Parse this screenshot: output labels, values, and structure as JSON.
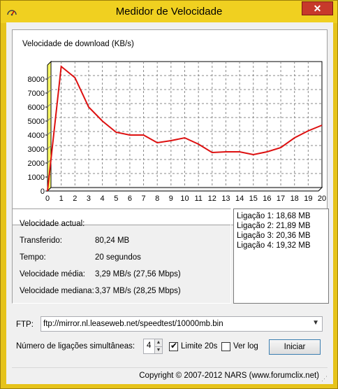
{
  "window": {
    "title": "Medidor de Velocidade",
    "icon": "speedometer-icon",
    "close_label": "✕"
  },
  "chart_data": {
    "type": "line",
    "title": "Velocidade de download (KB/s)",
    "x": [
      0,
      1,
      1.5,
      2,
      3,
      4,
      5,
      6,
      7,
      8,
      9,
      10,
      11,
      12,
      13,
      14,
      15,
      16,
      17,
      18,
      19,
      19.5,
      20
    ],
    "y": [
      0,
      8900,
      8500,
      8100,
      6000,
      5000,
      4200,
      4000,
      4000,
      3450,
      3600,
      3800,
      3350,
      2750,
      2800,
      2800,
      2600,
      2800,
      3100,
      3800,
      4300,
      4500,
      4700
    ],
    "xticks": [
      0,
      1,
      2,
      3,
      4,
      5,
      6,
      7,
      8,
      9,
      10,
      11,
      12,
      13,
      14,
      15,
      16,
      17,
      18,
      19,
      20
    ],
    "yticks": [
      0,
      1000,
      2000,
      3000,
      4000,
      5000,
      6000,
      7000,
      8000
    ],
    "xlim": [
      0,
      20
    ],
    "ylim": [
      0,
      9000
    ],
    "grid": true,
    "series_color": "#dd1010"
  },
  "stats": {
    "current_speed": {
      "label": "Velocidade actual:",
      "value": ""
    },
    "transferred": {
      "label": "Transferido:",
      "value": "80,24 MB"
    },
    "time": {
      "label": "Tempo:",
      "value": "20 segundos"
    },
    "avg_speed": {
      "label": "Velocidade média:",
      "value": "3,29 MB/s  (27,56 Mbps)"
    },
    "median_speed": {
      "label": "Velocidade mediana:",
      "value": "3,37 MB/s  (28,25 Mbps)"
    }
  },
  "connections": [
    "Ligação 1: 18,68 MB",
    "Ligação 2: 21,89 MB",
    "Ligação 3: 20,36 MB",
    "Ligação 4: 19,32 MB"
  ],
  "ftp": {
    "label": "FTP:",
    "value": "ftp://mirror.nl.leaseweb.net/speedtest/10000mb.bin"
  },
  "controls": {
    "connections_label": "Número de ligações simultâneas:",
    "connections_value": "4",
    "limit_label": "Limite 20s",
    "limit_checked": true,
    "log_label": "Ver log",
    "log_checked": false,
    "start_label": "Iniciar"
  },
  "status": {
    "copyright": "Copyright © 2007-2012 NARS (www.forumclix.net)"
  }
}
